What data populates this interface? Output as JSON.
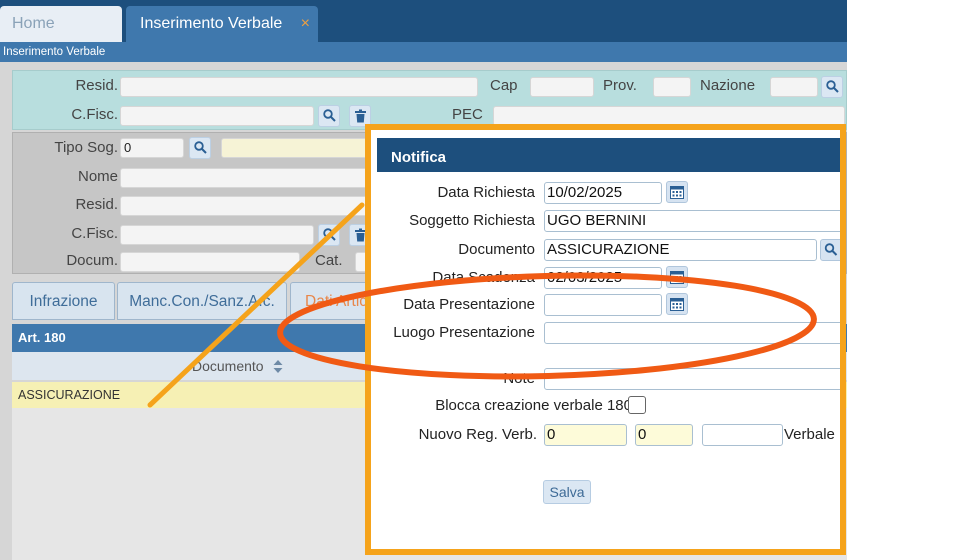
{
  "tabs": {
    "home": "Home",
    "active": "Inserimento Verbale",
    "close": "×"
  },
  "subtitle": "Inserimento Verbale",
  "top_panel": {
    "resid_label": "Resid.",
    "cap_label": "Cap",
    "prov_label": "Prov.",
    "nazione_label": "Nazione",
    "cfisc_label": "C.Fisc.",
    "pec_label": "PEC"
  },
  "mid_panel": {
    "tipo_sog_label": "Tipo Sog.",
    "tipo_sog_value": "0",
    "nome_label": "Nome",
    "resid_label": "Resid.",
    "cfisc_label": "C.Fisc.",
    "docum_label": "Docum.",
    "cat_label": "Cat."
  },
  "lower_tabs": [
    "Infrazione",
    "Manc.Con./Sanz.A.c.",
    "Dati Artic"
  ],
  "grid": {
    "header": "Art. 180",
    "column": "Documento",
    "row_value": "ASSICURAZIONE"
  },
  "dialog": {
    "title": "Notifica",
    "data_richiesta_label": "Data Richiesta",
    "data_richiesta_value": "10/02/2025",
    "soggetto_label": "Soggetto Richiesta",
    "soggetto_value": "UGO BERNINI",
    "documento_label": "Documento",
    "documento_value": "ASSICURAZIONE",
    "data_scadenza_label": "Data Scadenza",
    "data_scadenza_value": "02/03/2025",
    "data_presentazione_label": "Data Presentazione",
    "luogo_label": "Luogo Presentazione",
    "note_label": "Note",
    "blocca_label": "Blocca creazione verbale 180",
    "nuovo_reg_label": "Nuovo Reg. Verb.",
    "nuovo_reg_value1": "0",
    "nuovo_reg_value2": "0",
    "verbale_label": "Verbale",
    "save_label": "Salva"
  },
  "colors": {
    "accent_orange": "#f5a31b",
    "annotation_red": "#f05a14",
    "header_blue": "#1d4f7d"
  }
}
